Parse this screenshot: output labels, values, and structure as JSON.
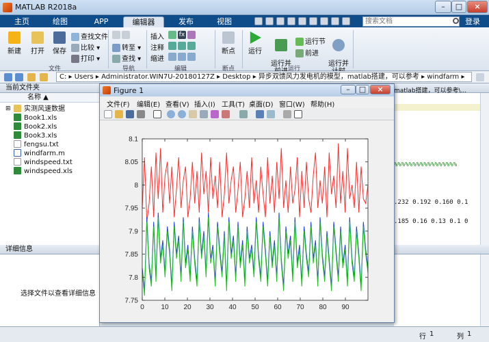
{
  "window": {
    "title": "MATLAB R2018a",
    "min": "–",
    "max": "□",
    "close": "×"
  },
  "tabs": [
    {
      "label": "主页",
      "active": false
    },
    {
      "label": "绘图",
      "active": false
    },
    {
      "label": "APP",
      "active": false
    },
    {
      "label": "编辑器",
      "active": true
    },
    {
      "label": "发布",
      "active": false
    },
    {
      "label": "视图",
      "active": false
    }
  ],
  "search": {
    "placeholder": "搜索文档"
  },
  "login": "登录",
  "ribbon": {
    "new": "新建",
    "open": "打开",
    "save": "保存",
    "find_files": "查找文件",
    "compare": "比较",
    "print": "打印",
    "goto": "转至",
    "find": "查找",
    "insert": "插入",
    "comment": "注释",
    "indent": "缩进",
    "breakpoints": "断点",
    "run": "运行",
    "run_advance": "运行并\n前进",
    "run_section": "运行节",
    "advance": "前进",
    "run_time": "运行并\n计时",
    "sections": {
      "file": "文件",
      "navigate": "导航",
      "edit": "编辑",
      "breakpoints": "断点",
      "run": "运行"
    }
  },
  "address": {
    "path": "C: ▸ Users ▸ Administrator.WIN7U-20180127Z ▸ Desktop ▸ 异步双馈风力发电机的模型，matlab搭建，可以参考 ▸ windfarm ▸"
  },
  "current_folder": {
    "title": "当前文件夹",
    "column": "名称 ▲",
    "items": [
      {
        "name": "实测风速数据",
        "type": "folder"
      },
      {
        "name": "Book1.xls",
        "type": "xls"
      },
      {
        "name": "Book2.xls",
        "type": "xls"
      },
      {
        "name": "Book3.xls",
        "type": "xls"
      },
      {
        "name": "fengsu.txt",
        "type": "txt"
      },
      {
        "name": "windfarm.m",
        "type": "m"
      },
      {
        "name": "windspeed.txt",
        "type": "txt"
      },
      {
        "name": "windspeed.xls",
        "type": "xls"
      }
    ]
  },
  "details": {
    "title": "详细信息",
    "hint": "选择文件以查看详细信息"
  },
  "editor_lines": [
    "matlab搭建，可以参考\\...",
    "%%%%%%%%%%%%%%%%%",
    ".232 0.192 0.160 0.1",
    ".185 0.16 0.13 0.1 0"
  ],
  "figure": {
    "title": "Figure 1",
    "menu": [
      "文件(F)",
      "编辑(E)",
      "查看(V)",
      "插入(I)",
      "工具(T)",
      "桌面(D)",
      "窗口(W)",
      "帮助(H)"
    ]
  },
  "chart_data": {
    "type": "line",
    "xlim": [
      0,
      100
    ],
    "ylim": [
      7.75,
      8.1
    ],
    "xticks": [
      0,
      10,
      20,
      30,
      40,
      50,
      60,
      70,
      80,
      90
    ],
    "yticks": [
      7.75,
      7.8,
      7.85,
      7.9,
      7.95,
      8,
      8.05,
      8.1
    ],
    "grid": false,
    "series": [
      {
        "color": "#ff2b2b",
        "values": [
          7.95,
          8.06,
          7.92,
          7.96,
          8.04,
          7.93,
          8.07,
          7.97,
          8.08,
          7.94,
          8.02,
          8.05,
          7.96,
          8.04,
          7.93,
          7.99,
          8.06,
          7.95,
          8.01,
          8.04,
          7.93,
          7.97,
          8.05,
          7.96,
          8.03,
          7.94,
          8.07,
          7.98,
          8.03,
          7.94,
          8.06,
          7.97,
          8.02,
          7.95,
          8.05,
          7.93,
          7.98,
          8.07,
          7.96,
          8.01,
          8.04,
          7.94,
          7.99,
          8.05,
          7.93,
          7.97,
          8.03,
          7.95,
          8.06,
          7.96,
          8.01,
          7.94,
          8.04,
          7.98,
          7.93,
          8.06,
          7.96,
          8.02,
          7.94,
          8.05,
          7.97,
          8.08,
          7.95,
          8.01,
          7.94,
          8.04,
          7.96,
          7.99,
          8.06,
          7.93,
          8.03,
          7.95,
          8.05,
          7.97,
          7.94,
          8.02,
          8.07,
          7.95,
          8.01,
          7.96,
          8.04,
          7.93,
          8.07,
          7.98,
          8.02,
          7.95,
          8.09,
          7.96,
          8.03,
          7.94,
          8.08,
          7.97,
          8.0,
          7.95,
          8.05,
          7.94,
          8.04,
          7.97,
          7.96,
          8.0
        ]
      },
      {
        "color": "#1b3fd8",
        "values": [
          7.82,
          7.77,
          7.93,
          7.83,
          7.79,
          7.92,
          7.8,
          7.94,
          7.84,
          7.88,
          7.81,
          7.91,
          7.86,
          7.78,
          7.92,
          7.85,
          7.89,
          7.8,
          7.93,
          7.83,
          7.87,
          7.8,
          7.91,
          7.84,
          7.79,
          7.93,
          7.85,
          7.9,
          7.81,
          7.94,
          7.84,
          7.87,
          7.79,
          7.92,
          7.86,
          7.81,
          7.9,
          7.78,
          7.93,
          7.85,
          7.89,
          7.8,
          7.92,
          7.83,
          7.88,
          7.79,
          7.91,
          7.84,
          7.87,
          7.81,
          7.93,
          7.85,
          7.8,
          7.92,
          7.86,
          7.79,
          7.9,
          7.83,
          7.88,
          7.8,
          7.94,
          7.84,
          7.78,
          7.91,
          7.85,
          7.89,
          7.8,
          7.93,
          7.83,
          7.87,
          7.79,
          7.91,
          7.85,
          7.81,
          7.92,
          7.84,
          7.88,
          7.79,
          7.93,
          7.85,
          7.8,
          7.9,
          7.84,
          7.78,
          7.92,
          7.86,
          7.8,
          7.91,
          7.83,
          7.87,
          7.79,
          7.93,
          7.84,
          7.8,
          7.91,
          7.85,
          7.78,
          7.92,
          7.86,
          7.82
        ]
      },
      {
        "color": "#19c719",
        "values": [
          7.81,
          7.76,
          7.92,
          7.82,
          7.78,
          7.91,
          7.79,
          7.93,
          7.83,
          7.87,
          7.8,
          7.9,
          7.85,
          7.77,
          7.91,
          7.84,
          7.88,
          7.79,
          7.92,
          7.82,
          7.86,
          7.79,
          7.9,
          7.83,
          7.78,
          7.92,
          7.84,
          7.89,
          7.8,
          7.93,
          7.83,
          7.86,
          7.78,
          7.91,
          7.85,
          7.8,
          7.89,
          7.77,
          7.92,
          7.84,
          7.88,
          7.79,
          7.91,
          7.82,
          7.87,
          7.78,
          7.9,
          7.83,
          7.86,
          7.8,
          7.92,
          7.84,
          7.79,
          7.91,
          7.85,
          7.78,
          7.89,
          7.82,
          7.87,
          7.79,
          7.93,
          7.83,
          7.77,
          7.9,
          7.84,
          7.88,
          7.79,
          7.92,
          7.82,
          7.86,
          7.78,
          7.9,
          7.84,
          7.8,
          7.91,
          7.83,
          7.87,
          7.78,
          7.92,
          7.84,
          7.79,
          7.89,
          7.83,
          7.77,
          7.91,
          7.85,
          7.79,
          7.9,
          7.82,
          7.86,
          7.78,
          7.92,
          7.83,
          7.79,
          7.9,
          7.84,
          7.77,
          7.91,
          7.85,
          7.81
        ]
      }
    ]
  },
  "status": {
    "line_label": "行",
    "line_value": "1",
    "col_label": "列",
    "col_value": "1"
  }
}
